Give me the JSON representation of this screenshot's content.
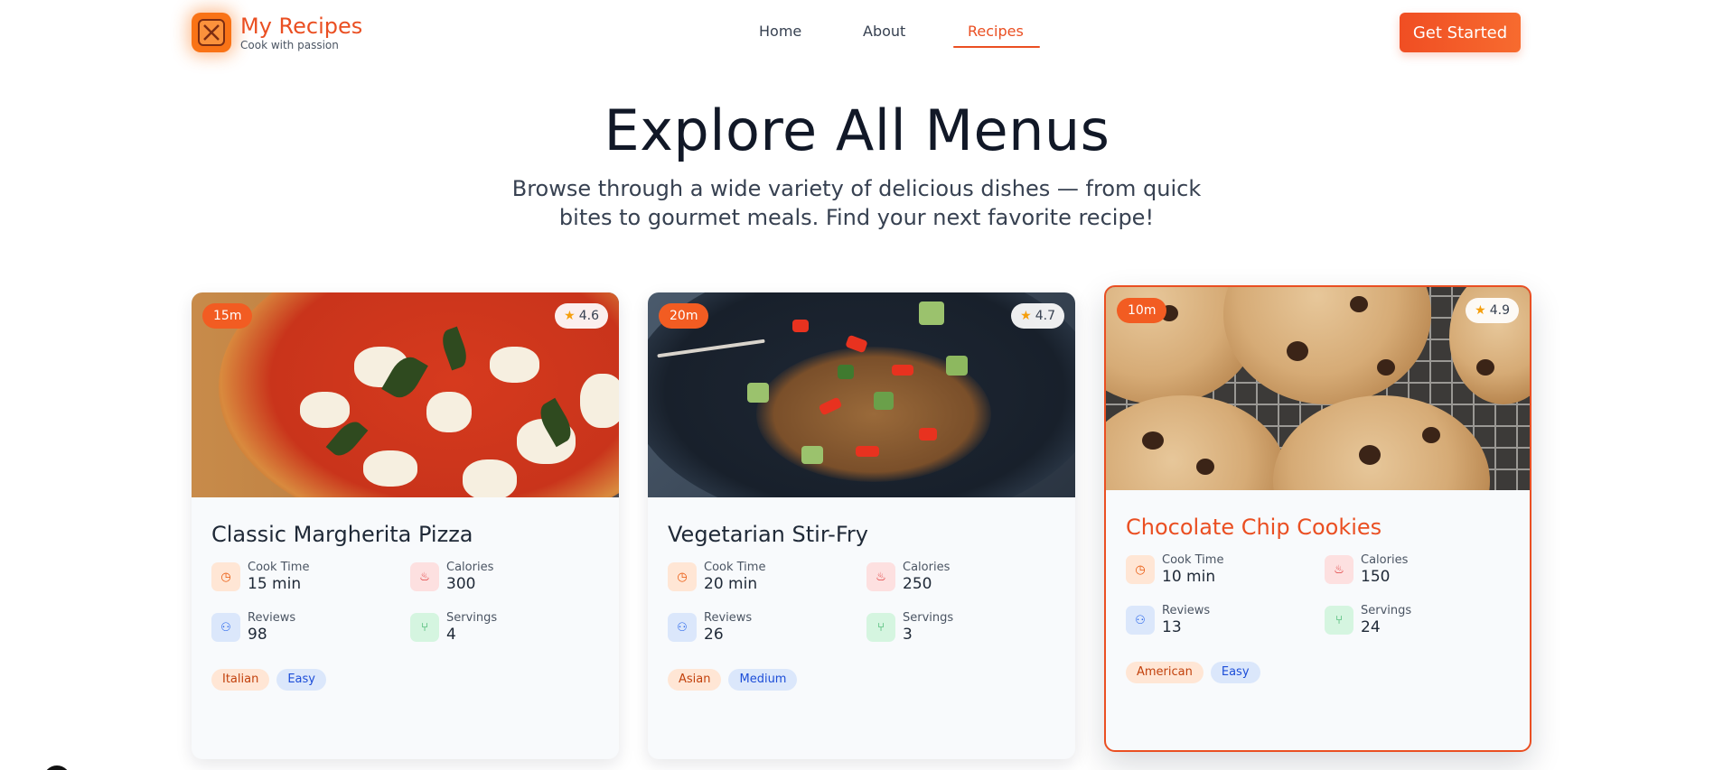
{
  "brand": {
    "title": "My Recipes",
    "tagline": "Cook with passion"
  },
  "nav": {
    "home": "Home",
    "about": "About",
    "recipes": "Recipes",
    "active": "Recipes"
  },
  "cta": {
    "label": "Get Started"
  },
  "hero": {
    "title": "Explore All Menus",
    "subtitle": "Browse through a wide variety of delicious dishes — from quick bites to gourmet meals. Find your next favorite recipe!"
  },
  "stat_labels": {
    "cook_time": "Cook Time",
    "calories": "Calories",
    "reviews": "Reviews",
    "servings": "Servings"
  },
  "recipes": [
    {
      "title": "Classic Margherita Pizza",
      "time_badge": "15m",
      "rating": "4.6",
      "cook_time": "15 min",
      "calories": "300",
      "reviews": "98",
      "servings": "4",
      "cuisine": "Italian",
      "difficulty": "Easy",
      "image": "pizza-photo"
    },
    {
      "title": "Vegetarian Stir-Fry",
      "time_badge": "20m",
      "rating": "4.7",
      "cook_time": "20 min",
      "calories": "250",
      "reviews": "26",
      "servings": "3",
      "cuisine": "Asian",
      "difficulty": "Medium",
      "image": "stir-fry-photo"
    },
    {
      "title": "Chocolate Chip Cookies",
      "time_badge": "10m",
      "rating": "4.9",
      "cook_time": "10 min",
      "calories": "150",
      "reviews": "13",
      "servings": "24",
      "cuisine": "American",
      "difficulty": "Easy",
      "image": "cookies-photo",
      "highlighted": true
    }
  ],
  "colors": {
    "accent": "#ea4f22",
    "cta_gradient_start": "#f04e23",
    "cta_gradient_end": "#f76b2f",
    "heading": "#111827"
  },
  "icons": {
    "logo": "recipe-book-icon",
    "cook_time": "clock-icon",
    "calories": "flame-icon",
    "reviews": "users-icon",
    "servings": "utensils-icon",
    "rating": "star-icon"
  }
}
